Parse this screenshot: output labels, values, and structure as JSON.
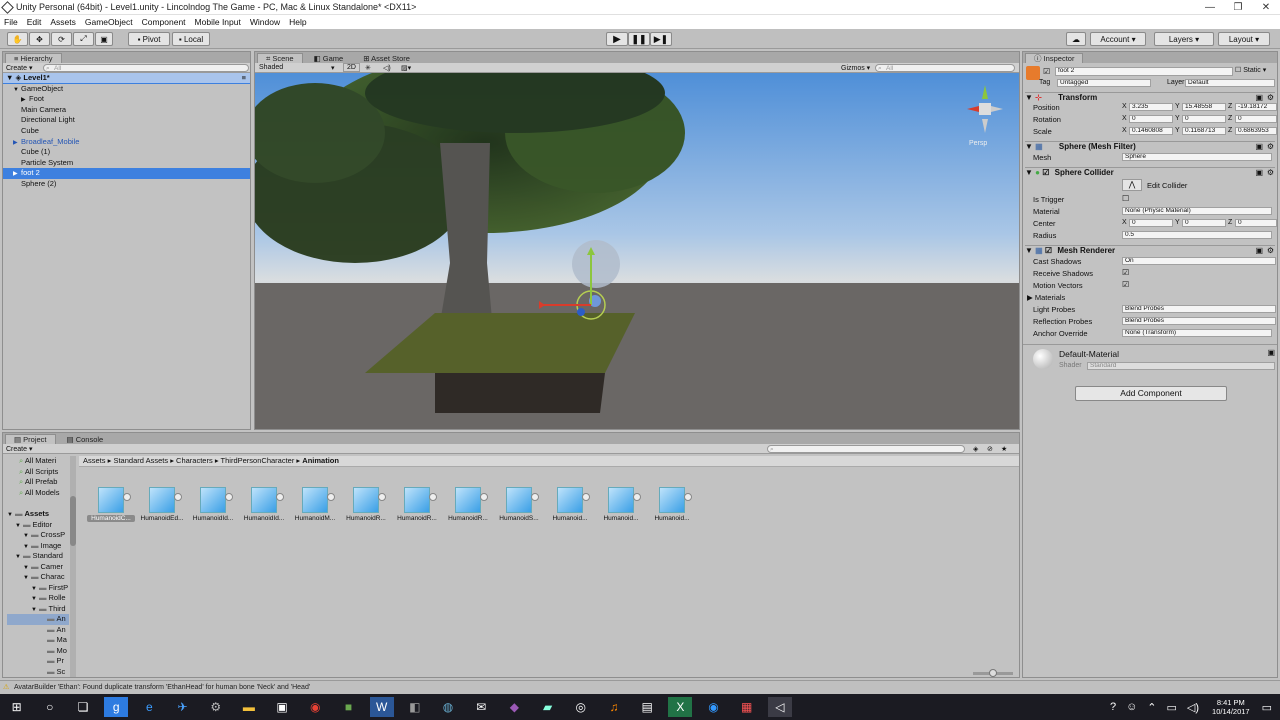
{
  "window": {
    "title": "Unity Personal (64bit) - Level1.unity - Lincolndog The Game - PC, Mac & Linux Standalone* <DX11>"
  },
  "menu": [
    "File",
    "Edit",
    "Assets",
    "GameObject",
    "Component",
    "Mobile Input",
    "Window",
    "Help"
  ],
  "toolbar": {
    "pivot": "Pivot",
    "local": "Local",
    "account": "Account",
    "layers": "Layers",
    "layout": "Layout"
  },
  "hierarchy": {
    "tab": "Hierarchy",
    "create": "Create",
    "search_placeholder": "All",
    "scene": "Level1*",
    "items": [
      {
        "label": "GameObject",
        "indent": 1,
        "arrow": "▼"
      },
      {
        "label": "Foot",
        "indent": 2,
        "arrow": "▶"
      },
      {
        "label": "Main Camera",
        "indent": 1,
        "arrow": ""
      },
      {
        "label": "Directional Light",
        "indent": 1,
        "arrow": ""
      },
      {
        "label": "Cube",
        "indent": 1,
        "arrow": ""
      },
      {
        "label": "Broadleaf_Mobile",
        "indent": 1,
        "arrow": "▶"
      },
      {
        "label": "Cube (1)",
        "indent": 1,
        "arrow": ""
      },
      {
        "label": "Particle System",
        "indent": 1,
        "arrow": ""
      },
      {
        "label": "foot 2",
        "indent": 1,
        "arrow": "▶"
      },
      {
        "label": "Sphere (2)",
        "indent": 1,
        "arrow": ""
      }
    ]
  },
  "scene": {
    "tabs": [
      "Scene",
      "Game",
      "Asset Store"
    ],
    "shading": "Shaded",
    "mode2d": "2D",
    "gizmos": "Gizmos",
    "search": "All",
    "persp": "Persp"
  },
  "inspector": {
    "tab": "Inspector",
    "object_name": "foot 2",
    "static": "Static",
    "tag_label": "Tag",
    "tag": "Untagged",
    "layer_label": "Layer",
    "layer": "Default",
    "transform": {
      "title": "Transform",
      "position": {
        "label": "Position",
        "x": "3.235",
        "y": "15.48558",
        "z": "-19.18172"
      },
      "rotation": {
        "label": "Rotation",
        "x": "0",
        "y": "0",
        "z": "0"
      },
      "scale": {
        "label": "Scale",
        "x": "0.1460808",
        "y": "0.1168713",
        "z": "0.6863953"
      }
    },
    "mesh_filter": {
      "title": "Sphere (Mesh Filter)",
      "mesh_label": "Mesh",
      "mesh": "Sphere"
    },
    "sphere_collider": {
      "title": "Sphere Collider",
      "edit": "Edit Collider",
      "is_trigger": "Is Trigger",
      "material_label": "Material",
      "material": "None (Physic Material)",
      "center_label": "Center",
      "cx": "0",
      "cy": "0",
      "cz": "0",
      "radius_label": "Radius",
      "radius": "0.5"
    },
    "mesh_renderer": {
      "title": "Mesh Renderer",
      "cast_shadows_label": "Cast Shadows",
      "cast_shadows": "On",
      "receive_shadows": "Receive Shadows",
      "motion_vectors": "Motion Vectors",
      "materials": "Materials",
      "light_probes_label": "Light Probes",
      "light_probes": "Blend Probes",
      "reflection_label": "Reflection Probes",
      "reflection": "Blend Probes",
      "anchor_label": "Anchor Override",
      "anchor": "None (Transform)"
    },
    "material": {
      "name": "Default-Material",
      "shader_label": "Shader",
      "shader": "Standard"
    },
    "add_component": "Add Component"
  },
  "project": {
    "tabs": [
      "Project",
      "Console"
    ],
    "create": "Create",
    "favorites": [
      "All Materi",
      "All Scripts",
      "All Prefab",
      "All Models"
    ],
    "tree": [
      {
        "label": "Assets",
        "indent": 0,
        "bold": true
      },
      {
        "label": "Editor",
        "indent": 1
      },
      {
        "label": "CrossP",
        "indent": 2
      },
      {
        "label": "Image",
        "indent": 2
      },
      {
        "label": "Standard",
        "indent": 1
      },
      {
        "label": "Camer",
        "indent": 2
      },
      {
        "label": "Charac",
        "indent": 2
      },
      {
        "label": "FirstP",
        "indent": 3
      },
      {
        "label": "Rolle",
        "indent": 3
      },
      {
        "label": "Third",
        "indent": 3
      },
      {
        "label": "An",
        "indent": 4,
        "selected": true
      },
      {
        "label": "An",
        "indent": 4
      },
      {
        "label": "Ma",
        "indent": 4
      },
      {
        "label": "Mo",
        "indent": 4
      },
      {
        "label": "Pr",
        "indent": 4
      },
      {
        "label": "Sc",
        "indent": 4
      }
    ],
    "breadcrumb": [
      "Assets",
      "Standard Assets",
      "Characters",
      "ThirdPersonCharacter",
      "Animation"
    ],
    "assets": [
      "HumanoidC...",
      "HumanoidEd...",
      "HumanoidId...",
      "HumanoidId...",
      "HumanoidM...",
      "HumanoidR...",
      "HumanoidR...",
      "HumanoidR...",
      "HumanoidS...",
      "Humanoid...",
      "Humanoid...",
      "Humanoid..."
    ]
  },
  "status": {
    "message": "AvatarBuilder 'Ethan': Found duplicate transform 'EthanHead' for human bone 'Neck' and 'Head'"
  },
  "taskbar": {
    "time": "8:41 PM",
    "date": "10/14/2017"
  },
  "colors": {
    "selection": "#3d80df",
    "panel": "#c2c2c2",
    "taskbar": "#1b1b22"
  }
}
